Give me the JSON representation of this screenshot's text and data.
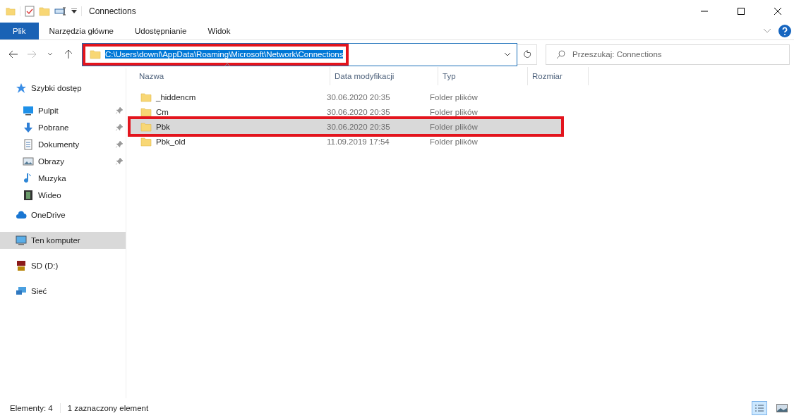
{
  "window": {
    "title": "Connections"
  },
  "ribbon": {
    "tabs": [
      {
        "label": "Plik",
        "selected": true
      },
      {
        "label": "Narzędzia główne",
        "selected": false
      },
      {
        "label": "Udostępnianie",
        "selected": false
      },
      {
        "label": "Widok",
        "selected": false
      }
    ]
  },
  "address": {
    "value": "C:\\Users\\downl\\AppData\\Roaming\\Microsoft\\Network\\Connections",
    "highlighted": true
  },
  "search": {
    "placeholder": "Przeszukaj: Connections"
  },
  "sidebar": {
    "items": [
      {
        "label": "Szybki dostęp",
        "kind": "star",
        "pinned": false,
        "selected": false,
        "section": true
      },
      {
        "label": "Pulpit",
        "kind": "desktop",
        "pinned": true,
        "selected": false,
        "section": false
      },
      {
        "label": "Pobrane",
        "kind": "download",
        "pinned": true,
        "selected": false,
        "section": false
      },
      {
        "label": "Dokumenty",
        "kind": "document",
        "pinned": true,
        "selected": false,
        "section": false
      },
      {
        "label": "Obrazy",
        "kind": "image",
        "pinned": true,
        "selected": false,
        "section": false
      },
      {
        "label": "Muzyka",
        "kind": "music",
        "pinned": false,
        "selected": false,
        "section": false
      },
      {
        "label": "Wideo",
        "kind": "video",
        "pinned": false,
        "selected": false,
        "section": false
      },
      {
        "label": "OneDrive",
        "kind": "cloud",
        "pinned": false,
        "selected": false,
        "section": true
      },
      {
        "label": "Ten komputer",
        "kind": "computer",
        "pinned": false,
        "selected": true,
        "section": true
      },
      {
        "label": "SD (D:)",
        "kind": "sd",
        "pinned": false,
        "selected": false,
        "section": true
      },
      {
        "label": "Sieć",
        "kind": "network",
        "pinned": false,
        "selected": false,
        "section": true
      }
    ]
  },
  "table": {
    "columns": [
      "Nazwa",
      "Data modyfikacji",
      "Typ",
      "Rozmiar"
    ],
    "rows": [
      {
        "name": "_hiddencm",
        "date": "30.06.2020 20:35",
        "type": "Folder plików",
        "selected": false,
        "highlighted": false
      },
      {
        "name": "Cm",
        "date": "30.06.2020 20:35",
        "type": "Folder plików",
        "selected": false,
        "highlighted": false
      },
      {
        "name": "Pbk",
        "date": "30.06.2020 20:35",
        "type": "Folder plików",
        "selected": true,
        "highlighted": true
      },
      {
        "name": "Pbk_old",
        "date": "11.09.2019 17:54",
        "type": "Folder plików",
        "selected": false,
        "highlighted": false
      }
    ]
  },
  "status_bar": {
    "count": "Elementy: 4",
    "selection": "1 zaznaczony element"
  }
}
